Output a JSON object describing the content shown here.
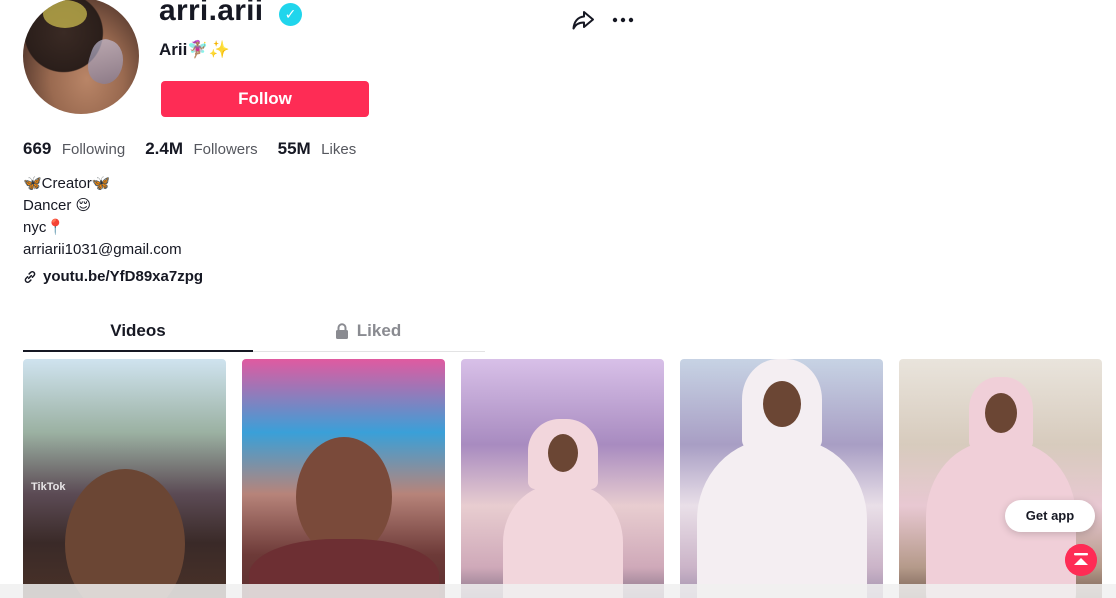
{
  "profile": {
    "username": "arri.arii",
    "nickname": "Arii🧚🏽‍♀️✨",
    "verified_mark": "✓",
    "follow_label": "Follow"
  },
  "stats": {
    "following_count": "669",
    "following_label": "Following",
    "followers_count": "2.4M",
    "followers_label": "Followers",
    "likes_count": "55M",
    "likes_label": "Likes"
  },
  "bio": {
    "line1": "🦋Creator🦋",
    "line2": "Dancer 😌",
    "line3": "nyc📍",
    "line4": "arriarii1031@gmail.com"
  },
  "link": {
    "text": "youtu.be/YfD89xa7zpg"
  },
  "tabs": {
    "videos": "Videos",
    "liked": "Liked"
  },
  "videos": [
    {
      "watermark": "TikTok"
    },
    {
      "watermark": ""
    },
    {
      "watermark": ""
    },
    {
      "watermark": ""
    },
    {
      "watermark": ""
    }
  ],
  "floating": {
    "get_app": "Get app"
  },
  "colors": {
    "accent": "#fe2c55",
    "verified": "#20d5ec",
    "text": "#161823",
    "muted": "#8a8b91"
  },
  "icons": [
    "share-icon",
    "more-icon",
    "link-icon",
    "lock-icon",
    "verified-icon",
    "scroll-top-icon"
  ]
}
